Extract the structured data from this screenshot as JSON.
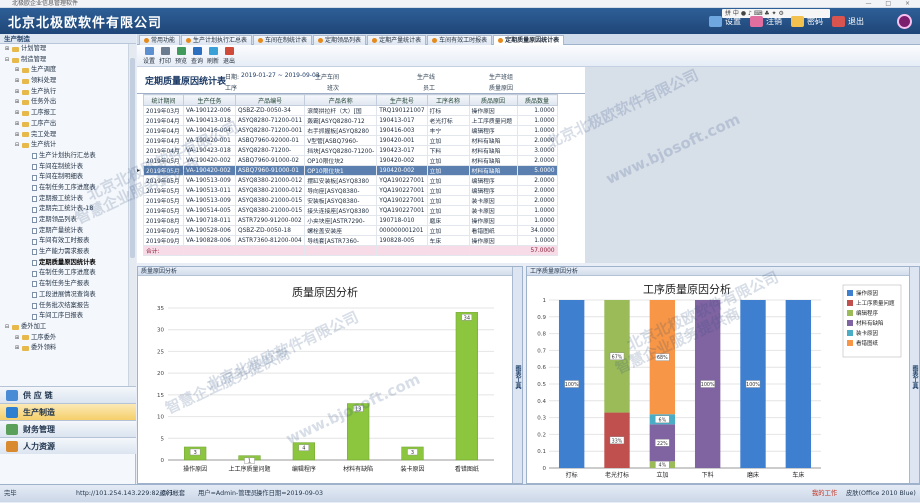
{
  "window": {
    "title": "北极欧企业信息管理软件",
    "controls": "— □ ×"
  },
  "header": {
    "logo": "北京北极欧软件有限公司",
    "tray": "拼 中 ● ♪ ⌨ ♣ ✦ ⚙",
    "buttons": [
      {
        "label": "设置",
        "icon": "gear-icon",
        "color": "#6fa8e0"
      },
      {
        "label": "注销",
        "icon": "lock-icon",
        "color": "#e06fa0"
      },
      {
        "label": "密码",
        "icon": "key-icon",
        "color": "#f2c14e"
      },
      {
        "label": "退出",
        "icon": "power-icon",
        "color": "#d9534f"
      }
    ]
  },
  "sidebar": {
    "title": "生产制造",
    "modules": [
      {
        "label": "供 应 链",
        "color": "#4a8bd6",
        "active": false
      },
      {
        "label": "生产制造",
        "color": "#2f7fd0",
        "active": true
      },
      {
        "label": "财务管理",
        "color": "#5aa05a",
        "active": false
      },
      {
        "label": "人力资源",
        "color": "#d98a2f",
        "active": false
      }
    ]
  },
  "tree": [
    {
      "label": "计划管理",
      "level": 0,
      "toggle": "⊞",
      "type": "folder"
    },
    {
      "label": "制造管理",
      "level": 0,
      "toggle": "⊟",
      "type": "folder"
    },
    {
      "label": "生产调度",
      "level": 1,
      "toggle": "⊞",
      "type": "folder"
    },
    {
      "label": "领料处理",
      "level": 1,
      "toggle": "⊞",
      "type": "folder"
    },
    {
      "label": "生产执行",
      "level": 1,
      "toggle": "⊞",
      "type": "folder"
    },
    {
      "label": "任务外出",
      "level": 1,
      "toggle": "⊞",
      "type": "folder"
    },
    {
      "label": "工序报工",
      "level": 1,
      "toggle": "⊞",
      "type": "folder"
    },
    {
      "label": "工序产出",
      "level": 1,
      "toggle": "⊞",
      "type": "folder"
    },
    {
      "label": "完工处理",
      "level": 1,
      "toggle": "⊞",
      "type": "folder"
    },
    {
      "label": "生产统计",
      "level": 1,
      "toggle": "⊟",
      "type": "folder"
    },
    {
      "label": "生产计划执行汇总表",
      "level": 2,
      "type": "doc"
    },
    {
      "label": "车间在制统计表",
      "level": 2,
      "type": "doc"
    },
    {
      "label": "车间在制明细表",
      "level": 2,
      "type": "doc"
    },
    {
      "label": "在制任务工序进度表",
      "level": 2,
      "type": "doc"
    },
    {
      "label": "定期报工统计表",
      "level": 2,
      "type": "doc"
    },
    {
      "label": "定期完工统计表-18",
      "level": 2,
      "type": "doc"
    },
    {
      "label": "定期领品列表",
      "level": 2,
      "type": "doc"
    },
    {
      "label": "定期产量统计表",
      "level": 2,
      "type": "doc"
    },
    {
      "label": "车间有效工时报表",
      "level": 2,
      "type": "doc"
    },
    {
      "label": "生产能力需求报表",
      "level": 2,
      "type": "doc"
    },
    {
      "label": "定期质量原因统计表",
      "level": 2,
      "type": "doc",
      "selected": true
    },
    {
      "label": "在制任务工序进度表",
      "level": 2,
      "type": "doc"
    },
    {
      "label": "在制任务生产报表",
      "level": 2,
      "type": "doc"
    },
    {
      "label": "工段进展情况查询表",
      "level": 2,
      "type": "doc"
    },
    {
      "label": "任务批次结案报告",
      "level": 2,
      "type": "doc"
    },
    {
      "label": "车间工序日报表",
      "level": 2,
      "type": "doc"
    },
    {
      "label": "委外加工",
      "level": 0,
      "toggle": "⊟",
      "type": "folder"
    },
    {
      "label": "工序委外",
      "level": 1,
      "toggle": "⊞",
      "type": "folder"
    },
    {
      "label": "委外领料",
      "level": 1,
      "toggle": "⊞",
      "type": "folder"
    }
  ],
  "tabs": [
    {
      "label": "常用功能"
    },
    {
      "label": "生产计划执行汇总表"
    },
    {
      "label": "车间在制统计表"
    },
    {
      "label": "定期领品列表"
    },
    {
      "label": "定期产量统计表"
    },
    {
      "label": "车间有效工时报表"
    },
    {
      "label": "定期质量原因统计表",
      "active": true
    }
  ],
  "toolbar": [
    {
      "label": "设置",
      "color": "#5b8fd0"
    },
    {
      "label": "打印",
      "color": "#6b7b90"
    },
    {
      "label": "预览",
      "color": "#3f9a5c"
    },
    {
      "label": "查询",
      "color": "#2c6fc0"
    },
    {
      "label": "刷新",
      "color": "#3aa0d8"
    },
    {
      "label": "退出",
      "color": "#d04a3a"
    }
  ],
  "filter": {
    "title": "定期质量原因统计表",
    "date_label": "日期:",
    "date_value": "2019-01-27 ~ 2019-09-03",
    "workshop_label": "生产车间",
    "line_label": "生产线",
    "team_label": "生产班组",
    "process_label": "工序",
    "shift_label": "班次",
    "worker_label": "员工",
    "reason_label": "质量原因"
  },
  "grid": {
    "columns": [
      "统计期间",
      "生产任务",
      "产品编号",
      "产品名称",
      "生产批号",
      "工序名称",
      "质品原因",
      "质品数量"
    ],
    "rows": [
      [
        "2019年03月",
        "VA-190122-006",
        "QSBZ-ZD-0050-34",
        "滚筒拼拉杆（大）[国",
        "TRQ190121007",
        "打标",
        "操作原因",
        "1.0000"
      ],
      [
        "2019年04月",
        "VA-190413-018",
        "ASYQ8280-71200-011",
        "轰霸[ASYQ8280-712",
        "190413-017",
        "老光打标",
        "上工序质量问题",
        "1.0000"
      ],
      [
        "2019年04月",
        "VA-190416-004",
        "ASYQ8280-71200-001",
        "右手抓握板[ASYQ8280",
        "190416-003",
        "丰宁",
        "编辑程序",
        "1.0000"
      ],
      [
        "2019年04月",
        "VA-190420-001",
        "ASBQ7960-92000-01",
        "V型管[ASBQ7960-",
        "190420-001",
        "立加",
        "材料有缺陷",
        "2.0000"
      ],
      [
        "2019年04月",
        "VA-190423-018",
        "ASYQ8280-71200-",
        "挡块[ASYQ8280-71200-",
        "190423-017",
        "下料",
        "材料有缺陷",
        "3.0000"
      ],
      [
        "2019年05月",
        "VA-190420-002",
        "ASBQ7960-91000-02",
        "OP10限位块2",
        "190420-002",
        "立加",
        "材料有缺陷",
        "2.0000"
      ],
      [
        "2019年05月",
        "VA-190420-002",
        "ASBQ7960-91000-01",
        "OP10限位块1",
        "190420-002",
        "立加",
        "材料有缺陷",
        "5.0000"
      ],
      [
        "2019年05月",
        "VA-190513-009",
        "ASYQ8380-21000-012",
        "摆缸安装板[ASYQ8380",
        "YQA190227001",
        "立加",
        "编辑程序",
        "2.0000"
      ],
      [
        "2019年05月",
        "VA-190513-011",
        "ASYQ8380-21000-012",
        "导向座[ASYQ8380-",
        "YQA190227001",
        "立加",
        "编辑程序",
        "2.0000"
      ],
      [
        "2019年05月",
        "VA-190513-009",
        "ASYQ8380-21000-015",
        "安装板[ASYQ8380-",
        "YQA190227001",
        "立加",
        "装卡原因",
        "2.0000"
      ],
      [
        "2019年05月",
        "VA-190514-005",
        "ASYQ8380-21000-015",
        "接头连接座[ASYQ8380",
        "YQA190227001",
        "立加",
        "装卡原因",
        "1.0000"
      ],
      [
        "2019年08月",
        "VA-190718-011",
        "ASTR7290-91200-002",
        "小夹块座[ASTR7290-",
        "190718-010",
        "磨床",
        "操作原因",
        "1.0000"
      ],
      [
        "2019年09月",
        "VA-190528-006",
        "QSBZ-ZD-0050-18",
        "螺栓盖安装座",
        "000000001201",
        "立加",
        "看错图纸",
        "34.0000"
      ],
      [
        "2019年09月",
        "VA-190828-006",
        "ASTR7360-81200-004",
        "导线套[ASTR7360-",
        "190828-005",
        "车床",
        "操作原因",
        "1.0000"
      ]
    ],
    "selected_row": 6,
    "sum_label": "合计:",
    "sum_value": "57.0000"
  },
  "chart_left": {
    "pane_title": "质量原因分析",
    "side_tab": "图表工具",
    "chart_data": {
      "type": "bar",
      "title": "质量原因分析",
      "categories": [
        "操作原因",
        "上工序质量问题",
        "编辑程序",
        "材料有缺陷",
        "装卡原因",
        "看错图纸"
      ],
      "values": [
        3,
        1,
        4,
        13,
        3,
        34
      ],
      "ylim": [
        0,
        35
      ],
      "yticks": [
        0,
        5,
        10,
        15,
        20,
        25,
        30,
        35
      ],
      "color": "#8cc63f",
      "grid": true
    }
  },
  "chart_right": {
    "pane_title": "工序质量原因分析",
    "side_tab": "图表工具",
    "chart_data": {
      "type": "bar",
      "title": "工序质量原因分析",
      "categories": [
        "打标",
        "老光打标",
        "立加",
        "下料",
        "磨床",
        "车床"
      ],
      "ylim": [
        0,
        1
      ],
      "yticks": [
        "0",
        "0.1",
        "0.2",
        "0.3",
        "0.4",
        "0.5",
        "0.6",
        "0.7",
        "0.8",
        "0.9",
        "1"
      ],
      "stacked": true,
      "legend_position": "right",
      "series": [
        {
          "name": "操作原因",
          "color": "#3f7fcf",
          "values": [
            1,
            0,
            0,
            0,
            1,
            1
          ]
        },
        {
          "name": "上工序质量问题",
          "color": "#c0504d",
          "values": [
            0,
            0.33,
            0,
            0,
            0,
            0
          ]
        },
        {
          "name": "编辑程序",
          "color": "#9bbb59",
          "values": [
            0,
            0.67,
            0.04,
            0,
            0,
            0
          ]
        },
        {
          "name": "材料有缺陷",
          "color": "#8064a2",
          "values": [
            0,
            0,
            0.22,
            1,
            0,
            0
          ]
        },
        {
          "name": "装卡原因",
          "color": "#4bacc6",
          "values": [
            0,
            0,
            0.06,
            0,
            0,
            0
          ]
        },
        {
          "name": "看错图纸",
          "color": "#f79646",
          "values": [
            0,
            0,
            0.68,
            0,
            0,
            0
          ]
        }
      ],
      "data_labels": [
        {
          "cat": 0,
          "series": 0,
          "text": "100%"
        },
        {
          "cat": 1,
          "series": 1,
          "text": "33%"
        },
        {
          "cat": 1,
          "series": 2,
          "text": "67%"
        },
        {
          "cat": 2,
          "series": 2,
          "text": "4%"
        },
        {
          "cat": 2,
          "series": 3,
          "text": "22%"
        },
        {
          "cat": 2,
          "series": 4,
          "text": "6%"
        },
        {
          "cat": 2,
          "series": 5,
          "text": "68%"
        },
        {
          "cat": 3,
          "series": 3,
          "text": "100%"
        },
        {
          "cat": 4,
          "series": 0,
          "text": "100%"
        }
      ]
    }
  },
  "statusbar": {
    "status": "完毕",
    "url": "http://101.254.143.229:82/001",
    "state": "运行帐套",
    "user": "用户=Admin-管理员",
    "date": "操作日期=2019-09-03",
    "work": "我的工作",
    "skin": "皮肤(Office 2010 Blue)"
  },
  "watermarks": [
    "北京北极欧软件有限公司",
    "www.bjosoft.com",
    "智慧企业服务提供商"
  ]
}
